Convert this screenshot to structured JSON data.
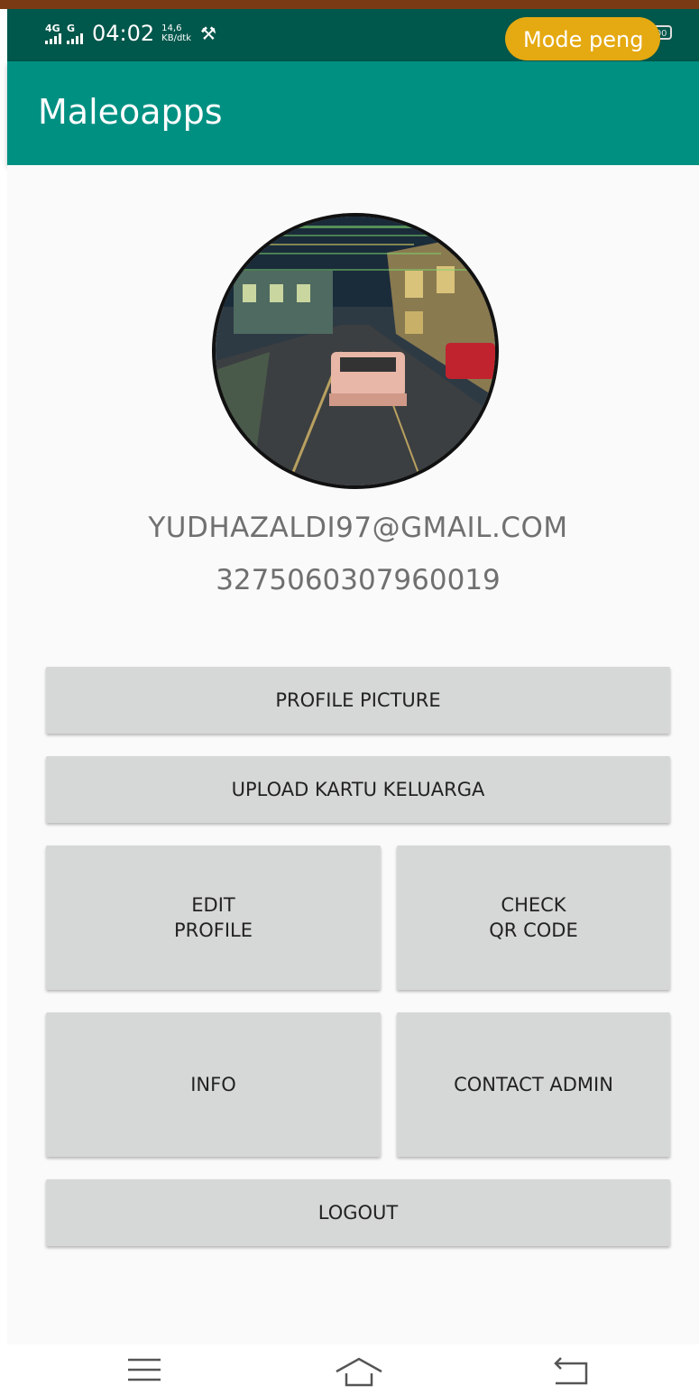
{
  "status_bar": {
    "network_1": "4G",
    "network_2": "G",
    "time": "04:02",
    "speed_value": "14,6",
    "speed_unit": "KB/dtk",
    "battery": "100",
    "mode_label": "Mode peng"
  },
  "app_bar": {
    "title": "Maleoapps"
  },
  "profile": {
    "email": "YUDHAZALDI97@GMAIL.COM",
    "nik": "3275060307960019"
  },
  "buttons": {
    "profile_picture": "PROFILE PICTURE",
    "upload_kk": "UPLOAD KARTU KELUARGA",
    "edit_profile": "EDIT\nPROFILE",
    "check_qr": "CHECK\nQR CODE",
    "info": "INFO",
    "contact_admin": "CONTACT ADMIN",
    "logout": "LOGOUT"
  },
  "icons": {
    "menu": "menu-icon",
    "home": "home-icon",
    "back": "back-icon",
    "tools": "tools-icon"
  },
  "colors": {
    "status_bar": "#00574b",
    "app_bar": "#009082",
    "button": "#d6d7d7",
    "mode_pill": "#e5a911"
  }
}
